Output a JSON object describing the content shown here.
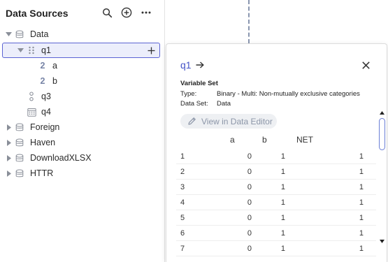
{
  "sidebar": {
    "title": "Data Sources",
    "tree": [
      {
        "label": "Data",
        "kind": "database",
        "expanded": true
      },
      {
        "label": "q1",
        "kind": "multi",
        "selected": true,
        "expanded": true
      },
      {
        "label": "a",
        "kind": "numeric-2",
        "badge": "2"
      },
      {
        "label": "b",
        "kind": "numeric-2",
        "badge": "2"
      },
      {
        "label": "q3",
        "kind": "ordinal"
      },
      {
        "label": "q4",
        "kind": "date"
      },
      {
        "label": "Foreign",
        "kind": "database",
        "expanded": false
      },
      {
        "label": "Haven",
        "kind": "database",
        "expanded": false
      },
      {
        "label": "DownloadXLSX",
        "kind": "database",
        "expanded": false
      },
      {
        "label": "HTTR",
        "kind": "database",
        "expanded": false
      }
    ]
  },
  "panel": {
    "title": "q1",
    "subtitle": "Variable Set",
    "type_label": "Type:",
    "type_value": "Binary - Multi: Non-mutually exclusive categories",
    "dataset_label": "Data Set:",
    "dataset_value": "Data",
    "view_button": "View in Data Editor",
    "table": {
      "headers": [
        "a",
        "b",
        "NET"
      ],
      "rows": [
        [
          "1",
          "0",
          "1",
          "1"
        ],
        [
          "2",
          "0",
          "1",
          "1"
        ],
        [
          "3",
          "0",
          "1",
          "1"
        ],
        [
          "4",
          "0",
          "1",
          "1"
        ],
        [
          "5",
          "0",
          "1",
          "1"
        ],
        [
          "6",
          "0",
          "1",
          "1"
        ],
        [
          "7",
          "0",
          "1",
          "1"
        ]
      ]
    }
  },
  "colors": {
    "accent": "#4453c7",
    "selection_bg": "#eceefb",
    "selection_border": "#5b63d3",
    "icon_gray": "#7784a6"
  }
}
